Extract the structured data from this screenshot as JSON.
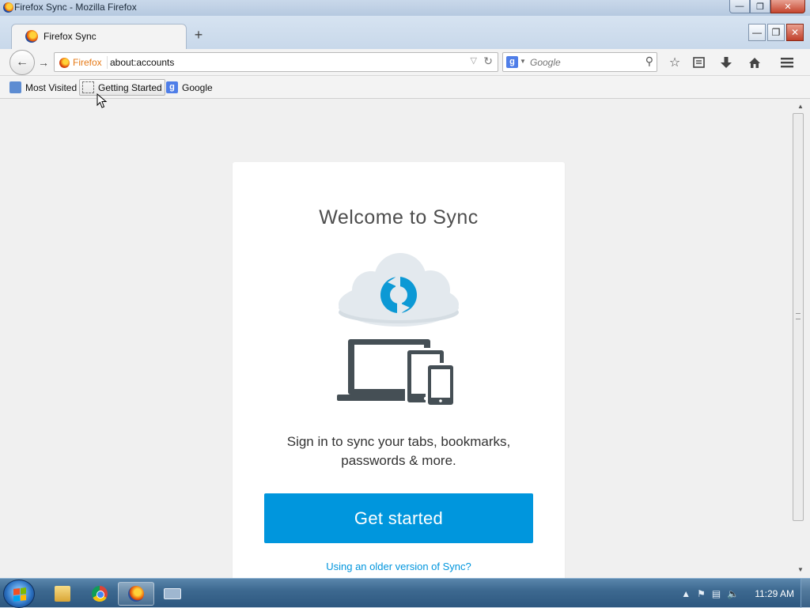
{
  "window": {
    "title": "Firefox Sync - Mozilla Firefox",
    "min_glyph": "—",
    "max_glyph": "❐",
    "close_glyph": "✕"
  },
  "tabs": [
    {
      "label": "Firefox Sync",
      "icon": "firefox-icon"
    }
  ],
  "newtab_glyph": "+",
  "navbar": {
    "back_glyph": "←",
    "forward_glyph": "→",
    "identity_label": "Firefox",
    "url": "about:accounts",
    "search_placeholder": "Google",
    "search_engine_letter": "g"
  },
  "toolbar_icons": [
    "star-icon",
    "reading-list-icon",
    "download-icon",
    "home-icon",
    "menu-icon"
  ],
  "bookmarks": [
    {
      "label": "Most Visited",
      "icon": "most-visited-icon"
    },
    {
      "label": "Getting Started",
      "icon": "getting-started-icon"
    },
    {
      "label": "Google",
      "icon": "google-icon"
    }
  ],
  "page": {
    "heading": "Welcome to Sync",
    "description": "Sign in to sync your tabs, bookmarks, passwords & more.",
    "cta_label": "Get started",
    "older_link": "Using an older version of Sync?"
  },
  "colors": {
    "accent": "#0096dd",
    "link": "#0095dd",
    "device": "#454f55",
    "cloud": "#e3e9ee"
  },
  "taskbar": {
    "apps": [
      "file-explorer-icon",
      "chrome-icon",
      "firefox-icon",
      "keyboard-icon"
    ],
    "clock": "11:29 AM"
  }
}
